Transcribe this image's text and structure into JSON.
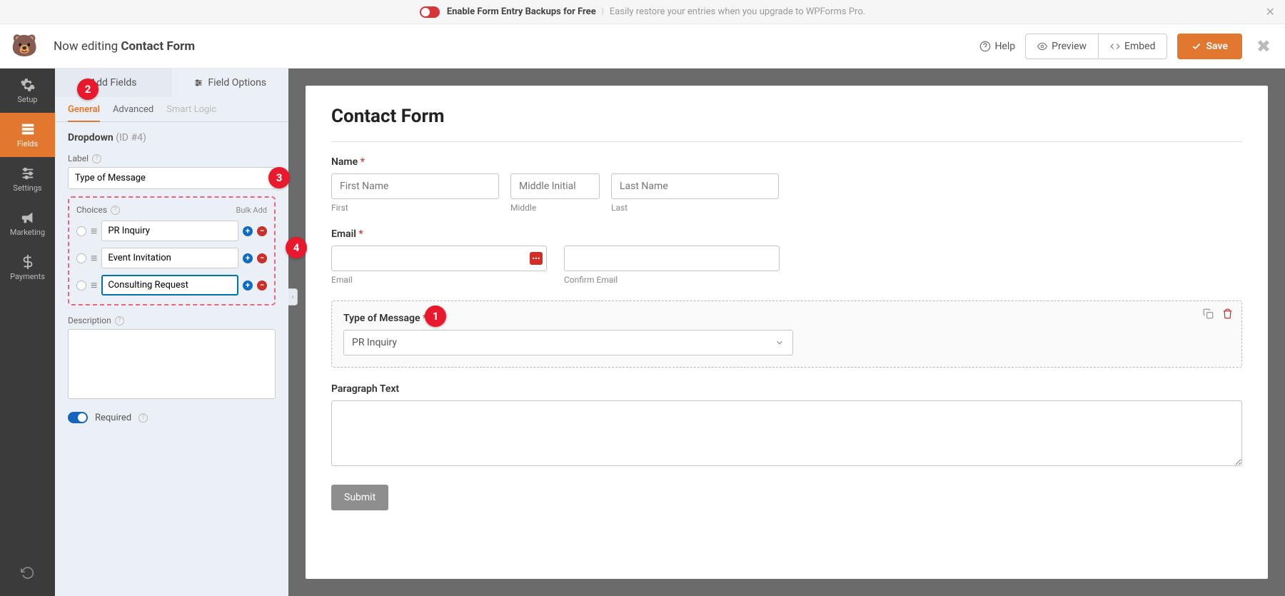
{
  "topBar": {
    "main": "Enable Form Entry Backups for Free",
    "sub": "Easily restore your entries when you upgrade to WPForms Pro."
  },
  "header": {
    "prefix": "Now editing ",
    "title": "Contact Form",
    "help": "Help",
    "preview": "Preview",
    "embed": "Embed",
    "save": "Save"
  },
  "nav": {
    "setup": "Setup",
    "fields": "Fields",
    "settings": "Settings",
    "marketing": "Marketing",
    "payments": "Payments"
  },
  "panel": {
    "tabAdd": "Add Fields",
    "tabOptions": "Field Options",
    "subTabs": {
      "general": "General",
      "advanced": "Advanced",
      "smart": "Smart Logic"
    },
    "fieldType": "Dropdown",
    "fieldId": "(ID #4)",
    "labelLabel": "Label",
    "labelValue": "Type of Message",
    "choicesLabel": "Choices",
    "bulkAdd": "Bulk Add",
    "choices": [
      "PR Inquiry",
      "Event Invitation",
      "Consulting Request"
    ],
    "descLabel": "Description",
    "requiredLabel": "Required"
  },
  "form": {
    "title": "Contact Form",
    "name": {
      "label": "Name",
      "first_ph": "First Name",
      "middle_ph": "Middle Initial",
      "last_ph": "Last Name",
      "first_sub": "First",
      "middle_sub": "Middle",
      "last_sub": "Last"
    },
    "email": {
      "label": "Email",
      "sub1": "Email",
      "sub2": "Confirm Email"
    },
    "typeMsg": {
      "label": "Type of Message",
      "selected": "PR Inquiry"
    },
    "paragraph": "Paragraph Text",
    "submit": "Submit"
  },
  "badges": {
    "b1": "1",
    "b2": "2",
    "b3": "3",
    "b4": "4"
  }
}
